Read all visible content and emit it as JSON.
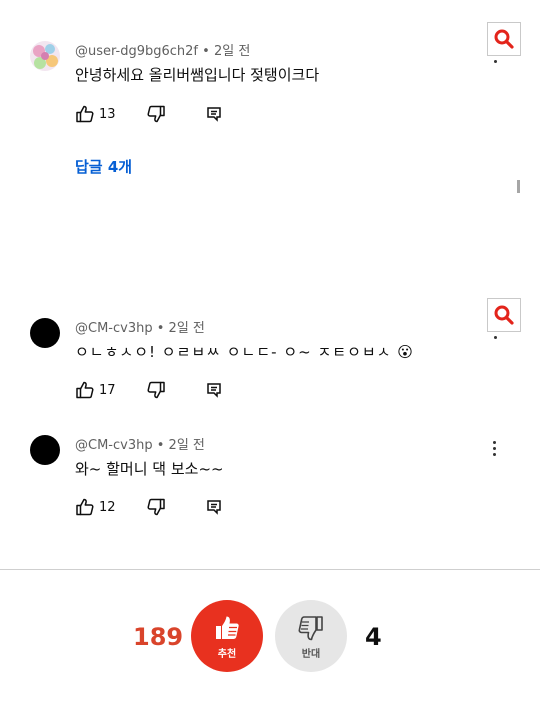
{
  "comments": [
    {
      "author": "@user-dg9bg6ch2f",
      "time": "2일 전",
      "text": "안녕하세요 올리버쌤입니다 젖탱이크다",
      "likes": "13",
      "replies_label": "답글 4개"
    },
    {
      "author": "@CM-cv3hp",
      "time": "2일 전",
      "text": "ㅇㄴㅎㅅㅇ! ㅇㄹㅂㅆ ㅇㄴㄷ- ㅇ~ ㅈㅌㅇㅂㅅ",
      "emoji": "😮",
      "likes": "17"
    },
    {
      "author": "@CM-cv3hp",
      "time": "2일 전",
      "text": "와~ 할머니 댁 보소~~",
      "likes": "12"
    }
  ],
  "separator": "•",
  "vote": {
    "up_count": "189",
    "up_label": "추천",
    "down_count": "4",
    "down_label": "반대"
  },
  "colors": {
    "accent_red": "#e8311f",
    "link_blue": "#065fd4",
    "up_count_color": "#d9442b"
  },
  "icons": [
    "search-icon",
    "thumbs-up-icon",
    "thumbs-down-icon",
    "reply-icon",
    "more-vert-icon"
  ]
}
